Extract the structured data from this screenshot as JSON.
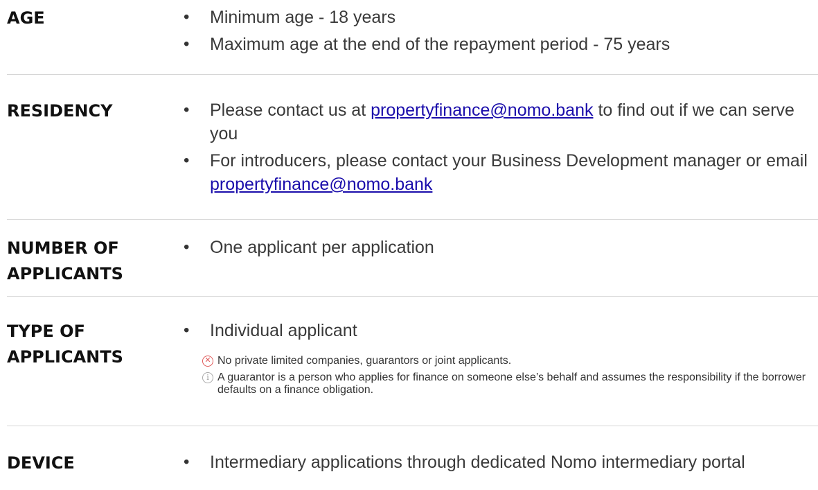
{
  "sections": {
    "age": {
      "heading": "AGE",
      "items": [
        "Minimum age - 18 years",
        "Maximum age at the end of the repayment period - 75 years"
      ]
    },
    "residency": {
      "heading": "RESIDENCY",
      "item1_before": "Please contact us at ",
      "item1_link": "propertyfinance@nomo.bank",
      "item1_after": " to find out if we can serve you",
      "item2_before": "For introducers, please contact your Business Development manager or email ",
      "item2_link": "propertyfinance@nomo.bank"
    },
    "applicants_number": {
      "heading": "NUMBER OF APPLICANTS",
      "items": [
        "One applicant per application"
      ]
    },
    "applicants_type": {
      "heading": "TYPE OF APPLICANTS",
      "items": [
        "Individual applicant"
      ],
      "notes": [
        {
          "icon": "close-circle-icon",
          "text": "No private limited companies, guarantors or joint applicants."
        },
        {
          "icon": "info-circle-icon",
          "text": "A guarantor is a person who applies for finance on someone else’s behalf and assumes the responsibility if the borrower defaults on a finance obligation."
        }
      ]
    },
    "device": {
      "heading": "DEVICE",
      "items": [
        "Intermediary applications through dedicated Nomo intermediary portal"
      ]
    }
  },
  "colors": {
    "link": "#1a0dab",
    "heading": "#111111",
    "body_text": "#3a3a3a",
    "divider": "#d6d6d6",
    "close_icon": "#e05a5a",
    "info_icon": "#aaaaaa"
  }
}
